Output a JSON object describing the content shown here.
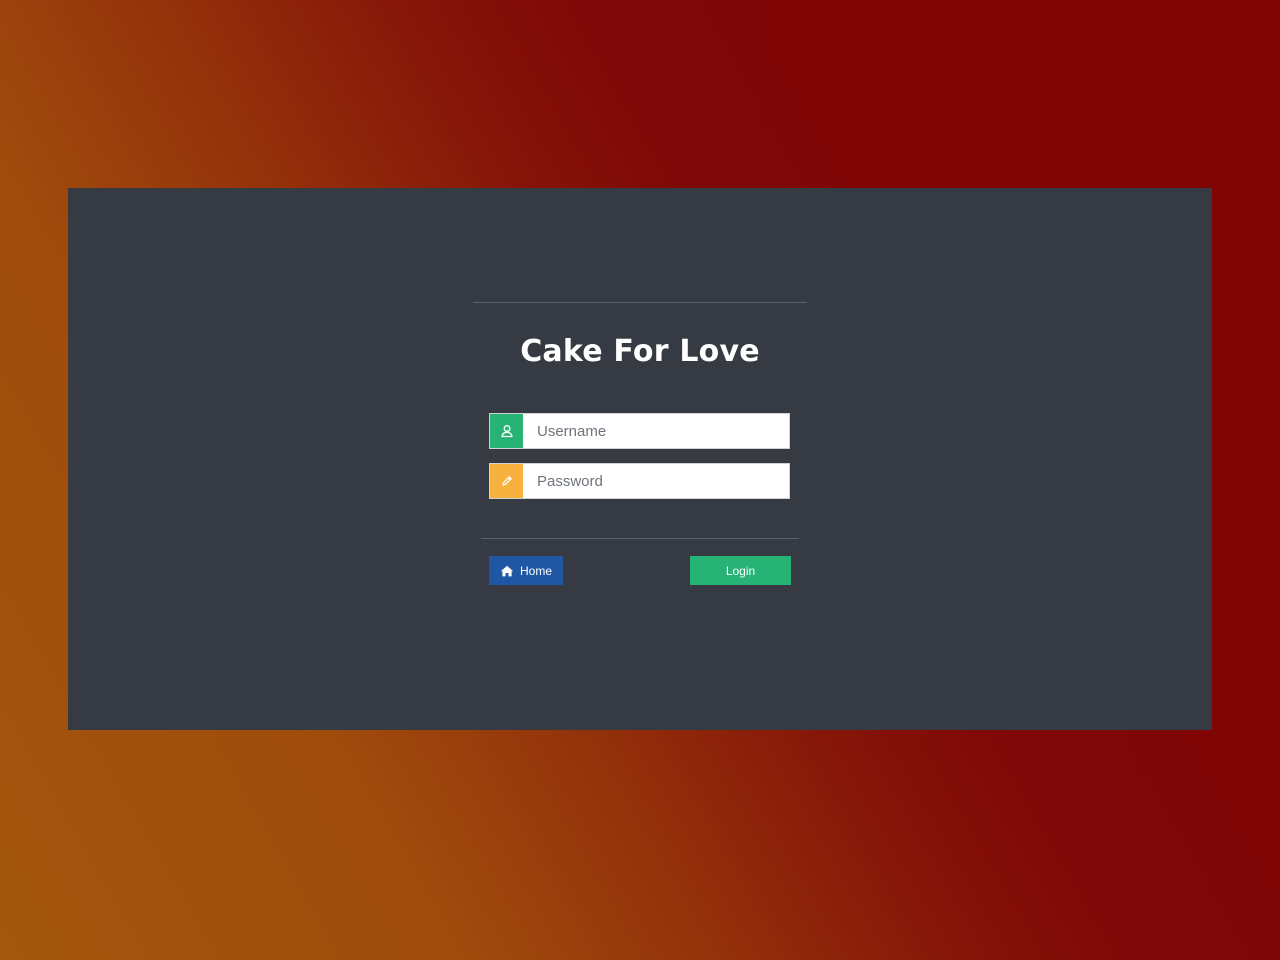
{
  "app": {
    "title": "Cake For Love"
  },
  "form": {
    "username": {
      "placeholder": "Username",
      "value": "",
      "icon": "user-icon"
    },
    "password": {
      "placeholder": "Password",
      "value": "",
      "icon": "pencil-icon"
    }
  },
  "actions": {
    "home_label": "Home",
    "home_icon": "home-icon",
    "login_label": "Login"
  },
  "colors": {
    "panel": "#363a42",
    "username_addon": "#26b375",
    "password_addon": "#f7b13e",
    "home_button": "#1f57a4",
    "login_button": "#26b375"
  }
}
